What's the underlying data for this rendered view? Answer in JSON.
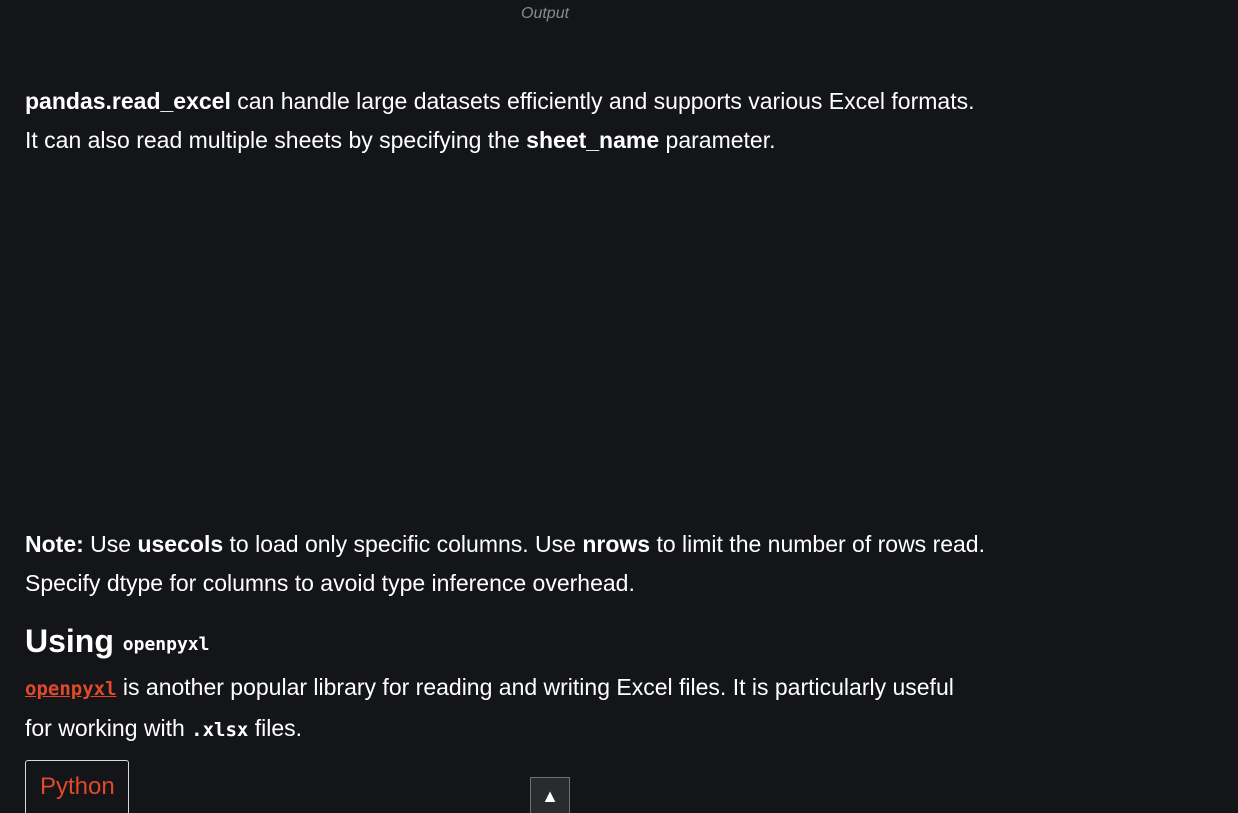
{
  "output_caption": "Output",
  "para1": {
    "line1_bold": "pandas.read_excel",
    "line1_rest": " can handle large datasets efficiently and supports various Excel formats.",
    "line2_pre": "It can also read multiple sheets by specifying the ",
    "line2_bold": "sheet_name",
    "line2_post": " parameter."
  },
  "note": {
    "label": "Note:",
    "t1": " Use ",
    "usecols": "usecols",
    "t2": " to load only specific columns. Use ",
    "nrows": "nrows",
    "t3": " to limit the number of rows read.",
    "line2": "Specify dtype for columns to avoid type inference overhead."
  },
  "section": {
    "heading_text": "Using ",
    "heading_code": "openpyxl"
  },
  "para3": {
    "link": "openpyxl",
    "t1": " is another popular library for reading and writing Excel files. It is particularly useful",
    "t2": "for working with ",
    "code": ".xlsx",
    "t3": " files."
  },
  "code_tab": {
    "label": "Python"
  },
  "scroll_top": {
    "icon": "arrow-up-icon",
    "glyph": "▲"
  },
  "colors": {
    "background": "#141519",
    "accent": "#e2492b",
    "text": "#ffffff",
    "muted": "#8a8b90"
  }
}
